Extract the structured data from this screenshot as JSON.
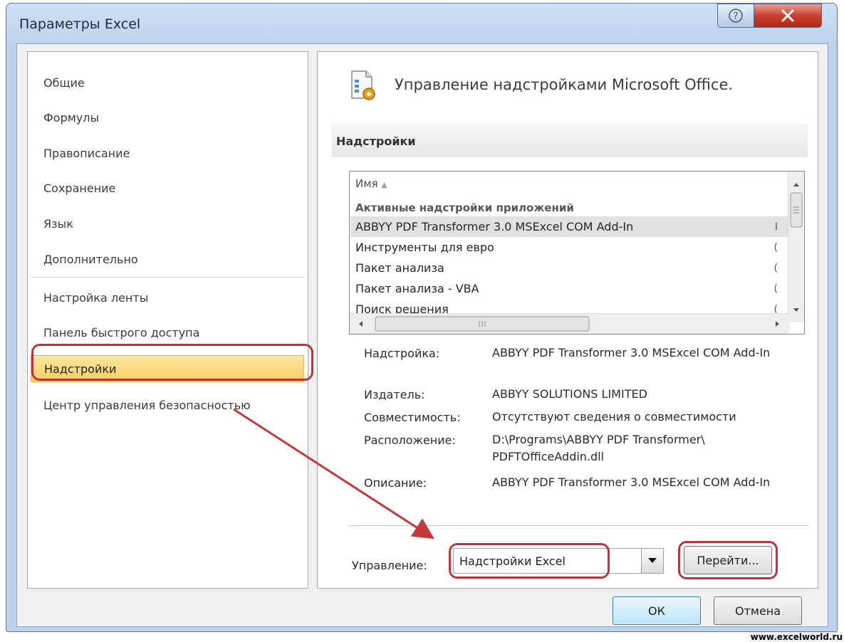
{
  "window": {
    "title": "Параметры Excel"
  },
  "nav": {
    "items": [
      {
        "label": "Общие"
      },
      {
        "label": "Формулы"
      },
      {
        "label": "Правописание"
      },
      {
        "label": "Сохранение"
      },
      {
        "label": "Язык"
      },
      {
        "label": "Дополнительно"
      },
      {
        "label": "Настройка ленты"
      },
      {
        "label": "Панель быстрого доступа"
      },
      {
        "label": "Надстройки",
        "selected": true
      },
      {
        "label": "Центр управления безопасностью"
      }
    ]
  },
  "content": {
    "header_title": "Управление надстройками Microsoft Office.",
    "section_title": "Надстройки",
    "list": {
      "column_header": "Имя",
      "group_header": "Активные надстройки приложений",
      "rows": [
        {
          "name": "ABBYY PDF Transformer 3.0 MSExcel COM Add-In",
          "trunc": "I",
          "selected": true
        },
        {
          "name": "Инструменты для евро",
          "trunc": "("
        },
        {
          "name": "Пакет анализа",
          "trunc": "("
        },
        {
          "name": "Пакет анализа - VBA",
          "trunc": "("
        },
        {
          "name": "Поиск решения",
          "trunc": "("
        }
      ]
    },
    "details": {
      "addin_label": "Надстройка:",
      "addin_value": "ABBYY PDF Transformer 3.0 MSExcel COM Add-In",
      "publisher_label": "Издатель:",
      "publisher_value": "ABBYY SOLUTIONS LIMITED",
      "compat_label": "Совместимость:",
      "compat_value": "Отсутствуют сведения о совместимости",
      "location_label": "Расположение:",
      "location_value": "D:\\Programs\\ABBYY PDF Transformer\\ PDFTOfficeAddin.dll",
      "description_label": "Описание:",
      "description_value": "ABBYY PDF Transformer 3.0 MSExcel COM Add-In"
    },
    "manage": {
      "label": "Управление:",
      "selected": "Надстройки Excel",
      "go_button": "Перейти..."
    }
  },
  "footer": {
    "ok": "ОК",
    "cancel": "Отмена"
  },
  "watermark": "www.excelworld.ru",
  "colors": {
    "selection": "#f8cf62",
    "annotation": "#b7373b",
    "close_button": "#c9402e"
  }
}
